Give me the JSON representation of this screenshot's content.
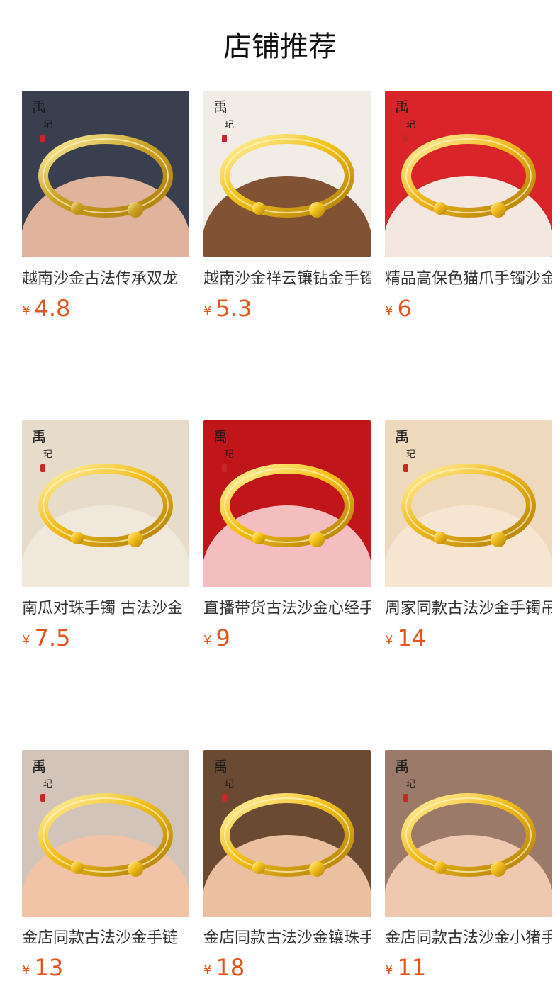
{
  "section": {
    "title": "店铺推荐"
  },
  "currency": "¥",
  "products": [
    {
      "name": "越南沙金古法传承双龙",
      "price": "4.8",
      "bg": "#3a3f4f",
      "skin": "#e8b9a0",
      "accent": "#c9a227",
      "brand": "禹玘"
    },
    {
      "name": "越南沙金祥云镶钻金手镯",
      "price": "5.3",
      "bg": "#f1ece6",
      "skin": "#7a4a2a",
      "accent": "#f2c21b",
      "brand": "禹玘"
    },
    {
      "name": "精品高保色猫爪手镯沙金",
      "price": "6",
      "bg": "#d9252a",
      "skin": "#f4f1ea",
      "accent": "#f0b81d",
      "brand": "禹玘"
    },
    {
      "name": "南瓜对珠手镯 古法沙金",
      "price": "7.5",
      "bg": "#e7dcc9",
      "skin": "#efe8dc",
      "accent": "#f1bd1c",
      "brand": "禹玘"
    },
    {
      "name": "直播带货古法沙金心经手镯",
      "price": "9",
      "bg": "#c0161a",
      "skin": "#f7c6c9",
      "accent": "#f6c315",
      "brand": "禹玘"
    },
    {
      "name": "周家同款古法沙金手镯吊坠",
      "price": "14",
      "bg": "#efd9bd",
      "skin": "#f4e6d2",
      "accent": "#f0b81b",
      "brand": "禹玘"
    },
    {
      "name": "金店同款古法沙金手链",
      "price": "13",
      "bg": "#d2c4b8",
      "skin": "#f2c4a6",
      "accent": "#f0bd1a",
      "brand": "禹玘"
    },
    {
      "name": "金店同款古法沙金镶珠手链",
      "price": "18",
      "bg": "#6b4a33",
      "skin": "#f1c6a8",
      "accent": "#f2c01c",
      "brand": "禹玘"
    },
    {
      "name": "金店同款古法沙金小猪手链",
      "price": "11",
      "bg": "#9c7a6a",
      "skin": "#f3cdb3",
      "accent": "#f1bb1a",
      "brand": "禹玘"
    }
  ]
}
